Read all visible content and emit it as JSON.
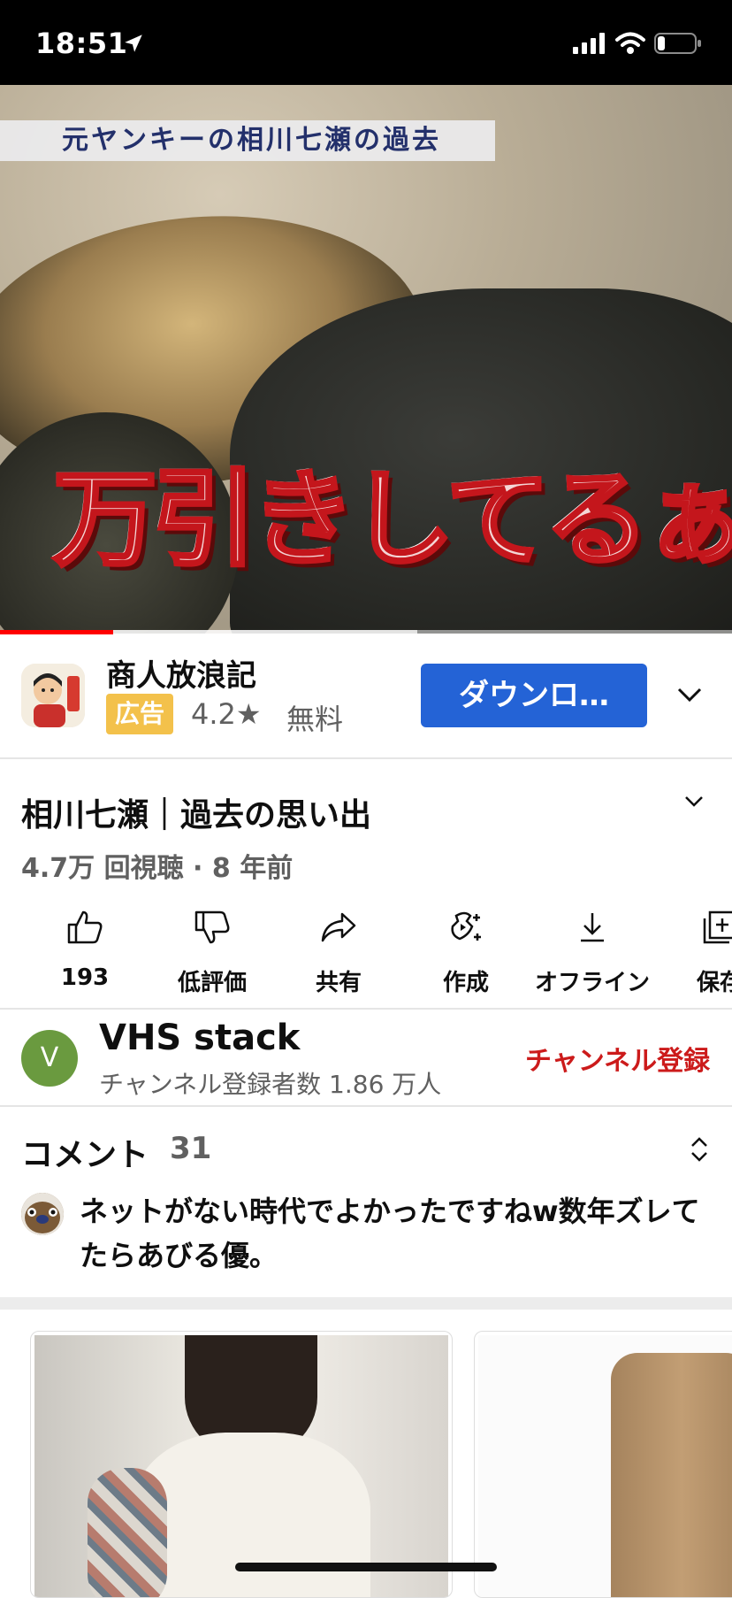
{
  "status_bar": {
    "time": "18:51"
  },
  "video": {
    "caption_top": "元ヤンキーの相川七瀬の過去",
    "caption_big": "万引きしてるぁ~",
    "progress_fraction": 0.155,
    "buffered_fraction": 0.57
  },
  "ad": {
    "app_name": "商人放浪記",
    "badge": "広告",
    "rating": "4.2★",
    "price": "無料",
    "button_label": "ダウンロ…"
  },
  "video_info": {
    "title": "相川七瀬｜過去の思い出",
    "meta": "4.7万 回視聴 · 8 年前"
  },
  "actions": [
    {
      "label": "193",
      "icon": "thumbs-up-icon"
    },
    {
      "label": "低評価",
      "icon": "thumbs-down-icon"
    },
    {
      "label": "共有",
      "icon": "share-icon"
    },
    {
      "label": "作成",
      "icon": "create-icon"
    },
    {
      "label": "オフライン",
      "icon": "download-icon"
    },
    {
      "label": "保存",
      "icon": "save-icon"
    }
  ],
  "channel": {
    "avatar_letter": "V",
    "name": "VHS stack",
    "subscribers": "チャンネル登録者数 1.86 万人",
    "subscribe_label": "チャンネル登録"
  },
  "comments": {
    "heading": "コメント",
    "count": "31",
    "top_comment": "ネットがない時代でよかったですねw数年ズレてたらあびる優。"
  },
  "colors": {
    "accent_red": "#ff0000",
    "subscribe_red": "#cc1b1b",
    "download_blue": "#2463d6",
    "ad_badge": "#f3c14b"
  }
}
